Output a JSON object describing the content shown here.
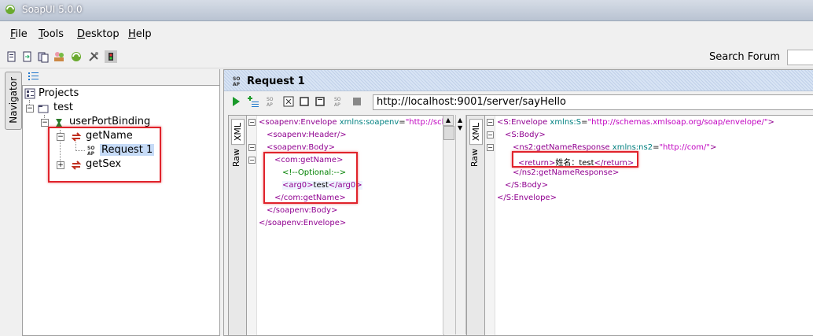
{
  "window": {
    "title": "SoapUI 5.0.0"
  },
  "menu": {
    "items": [
      {
        "first": "F",
        "rest": "ile"
      },
      {
        "first": "T",
        "rest": "ools"
      },
      {
        "first": "D",
        "rest": "esktop"
      },
      {
        "first": "H",
        "rest": "elp"
      }
    ]
  },
  "toolbar": {
    "icons": [
      "new-project-icon",
      "import-project-icon",
      "save-all-icon",
      "forum-icon",
      "trial-icon",
      "preferences-icon",
      "proxy-icon"
    ],
    "search_label": "Search Forum",
    "search_value": ""
  },
  "navigator": {
    "tab_label": "Navigator",
    "tree": {
      "root": "Projects",
      "project": "test",
      "interface": "userPortBinding",
      "operations": [
        {
          "name": "getName",
          "requests": [
            "Request 1"
          ]
        },
        {
          "name": "getSex",
          "requests": []
        }
      ]
    }
  },
  "request": {
    "title": "Request 1",
    "url": "http://localhost:9001/server/sayHello",
    "request_tabs": [
      "XML",
      "Raw"
    ],
    "response_tabs": [
      "XML",
      "Raw"
    ]
  },
  "request_xml": {
    "l1": {
      "tag": "<soapenv:Envelope",
      "ns": " xmlns:soapenv",
      "eq": "=",
      "val": "\"http://schem"
    },
    "l2": "<soapenv:Header/>",
    "l3": "<soapenv:Body>",
    "l4": "<com:getName>",
    "l5": "<!--Optional:-->",
    "l6": {
      "open": "<arg0>",
      "text": "test",
      "close": "</arg0>"
    },
    "l7": "</com:getName>",
    "l8": "</soapenv:Body>",
    "l9": "</soapenv:Envelope>"
  },
  "response_xml": {
    "l1": {
      "tag": "<S:Envelope",
      "ns": " xmlns:S",
      "eq": "=",
      "val": "\"http://schemas.xmlsoap.org/soap/envelope/\"",
      "end": ">"
    },
    "l2": "<S:Body>",
    "l3": {
      "tag": "<ns2:getNameResponse",
      "ns": " xmlns:ns2",
      "eq": "=",
      "val": "\"http://com/\"",
      "end": ">"
    },
    "l4": {
      "open": "<return>",
      "text": "姓名：test",
      "close": "</return>"
    },
    "l5": "</ns2:getNameResponse>",
    "l6": "</S:Body>",
    "l7": "</S:Envelope>"
  },
  "colors": {
    "highlight_box": "#e0232b",
    "xml_tag": "#900090",
    "xml_ns": "#008080",
    "xml_value": "#c000c0",
    "comment": "#008000"
  }
}
